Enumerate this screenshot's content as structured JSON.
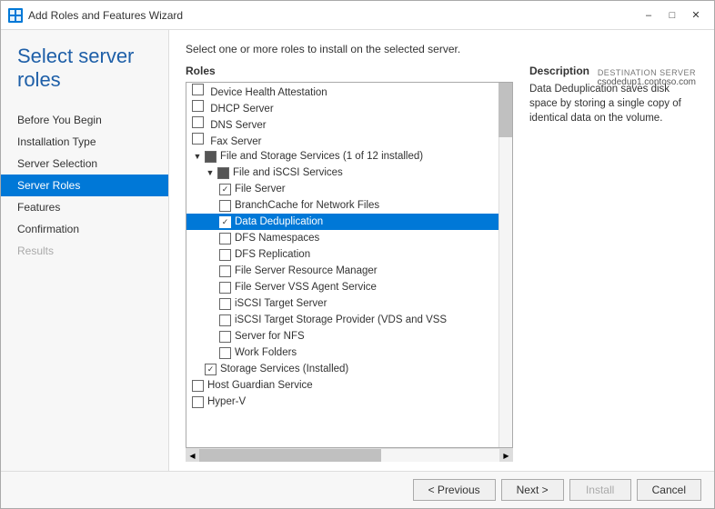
{
  "window": {
    "title": "Add Roles and Features Wizard",
    "icon": "wizard-icon"
  },
  "server_info": {
    "label": "DESTINATION SERVER",
    "hostname": "csodedup1.contoso.com"
  },
  "page_title": "Select server roles",
  "instruction": "Select one or more roles to install on the selected server.",
  "sidebar": {
    "items": [
      {
        "label": "Before You Begin",
        "state": "normal"
      },
      {
        "label": "Installation Type",
        "state": "normal"
      },
      {
        "label": "Server Selection",
        "state": "normal"
      },
      {
        "label": "Server Roles",
        "state": "active"
      },
      {
        "label": "Features",
        "state": "normal"
      },
      {
        "label": "Confirmation",
        "state": "normal"
      },
      {
        "label": "Results",
        "state": "disabled"
      }
    ]
  },
  "roles_panel": {
    "label": "Roles",
    "items": [
      {
        "id": "device-health-attestation",
        "label": "Device Health Attestation",
        "indent": 0,
        "checked": false,
        "type": "checkbox",
        "truncated": true
      },
      {
        "id": "dhcp-server",
        "label": "DHCP Server",
        "indent": 0,
        "checked": false,
        "type": "checkbox"
      },
      {
        "id": "dns-server",
        "label": "DNS Server",
        "indent": 0,
        "checked": false,
        "type": "checkbox"
      },
      {
        "id": "fax-server",
        "label": "Fax Server",
        "indent": 0,
        "checked": false,
        "type": "checkbox"
      },
      {
        "id": "file-storage-services",
        "label": "File and Storage Services (1 of 12 installed)",
        "indent": 0,
        "checked": "partial",
        "type": "expand-checked",
        "expanded": true
      },
      {
        "id": "file-iscsi-services",
        "label": "File and iSCSI Services",
        "indent": 1,
        "checked": "partial",
        "type": "expand-partial",
        "expanded": true
      },
      {
        "id": "file-server",
        "label": "File Server",
        "indent": 2,
        "checked": true,
        "type": "checkbox"
      },
      {
        "id": "branchcache",
        "label": "BranchCache for Network Files",
        "indent": 2,
        "checked": false,
        "type": "checkbox"
      },
      {
        "id": "data-dedup",
        "label": "Data Deduplication",
        "indent": 2,
        "checked": true,
        "type": "checkbox",
        "selected": true
      },
      {
        "id": "dfs-namespaces",
        "label": "DFS Namespaces",
        "indent": 2,
        "checked": false,
        "type": "checkbox"
      },
      {
        "id": "dfs-replication",
        "label": "DFS Replication",
        "indent": 2,
        "checked": false,
        "type": "checkbox"
      },
      {
        "id": "file-server-resource",
        "label": "File Server Resource Manager",
        "indent": 2,
        "checked": false,
        "type": "checkbox"
      },
      {
        "id": "file-server-vss",
        "label": "File Server VSS Agent Service",
        "indent": 2,
        "checked": false,
        "type": "checkbox"
      },
      {
        "id": "iscsi-target-server",
        "label": "iSCSI Target Server",
        "indent": 2,
        "checked": false,
        "type": "checkbox"
      },
      {
        "id": "iscsi-target-storage",
        "label": "iSCSI Target Storage Provider (VDS and VSS",
        "indent": 2,
        "checked": false,
        "type": "checkbox"
      },
      {
        "id": "server-nfs",
        "label": "Server for NFS",
        "indent": 2,
        "checked": false,
        "type": "checkbox"
      },
      {
        "id": "work-folders",
        "label": "Work Folders",
        "indent": 2,
        "checked": false,
        "type": "checkbox"
      },
      {
        "id": "storage-services",
        "label": "Storage Services (Installed)",
        "indent": 1,
        "checked": true,
        "type": "checkbox"
      },
      {
        "id": "host-guardian",
        "label": "Host Guardian Service",
        "indent": 0,
        "checked": false,
        "type": "checkbox"
      },
      {
        "id": "hyper-v",
        "label": "Hyper-V",
        "indent": 0,
        "checked": false,
        "type": "checkbox",
        "truncated": true
      }
    ]
  },
  "description": {
    "label": "Description",
    "text": "Data Deduplication saves disk space by storing a single copy of identical data on the volume."
  },
  "footer": {
    "previous_label": "< Previous",
    "next_label": "Next >",
    "install_label": "Install",
    "cancel_label": "Cancel"
  }
}
